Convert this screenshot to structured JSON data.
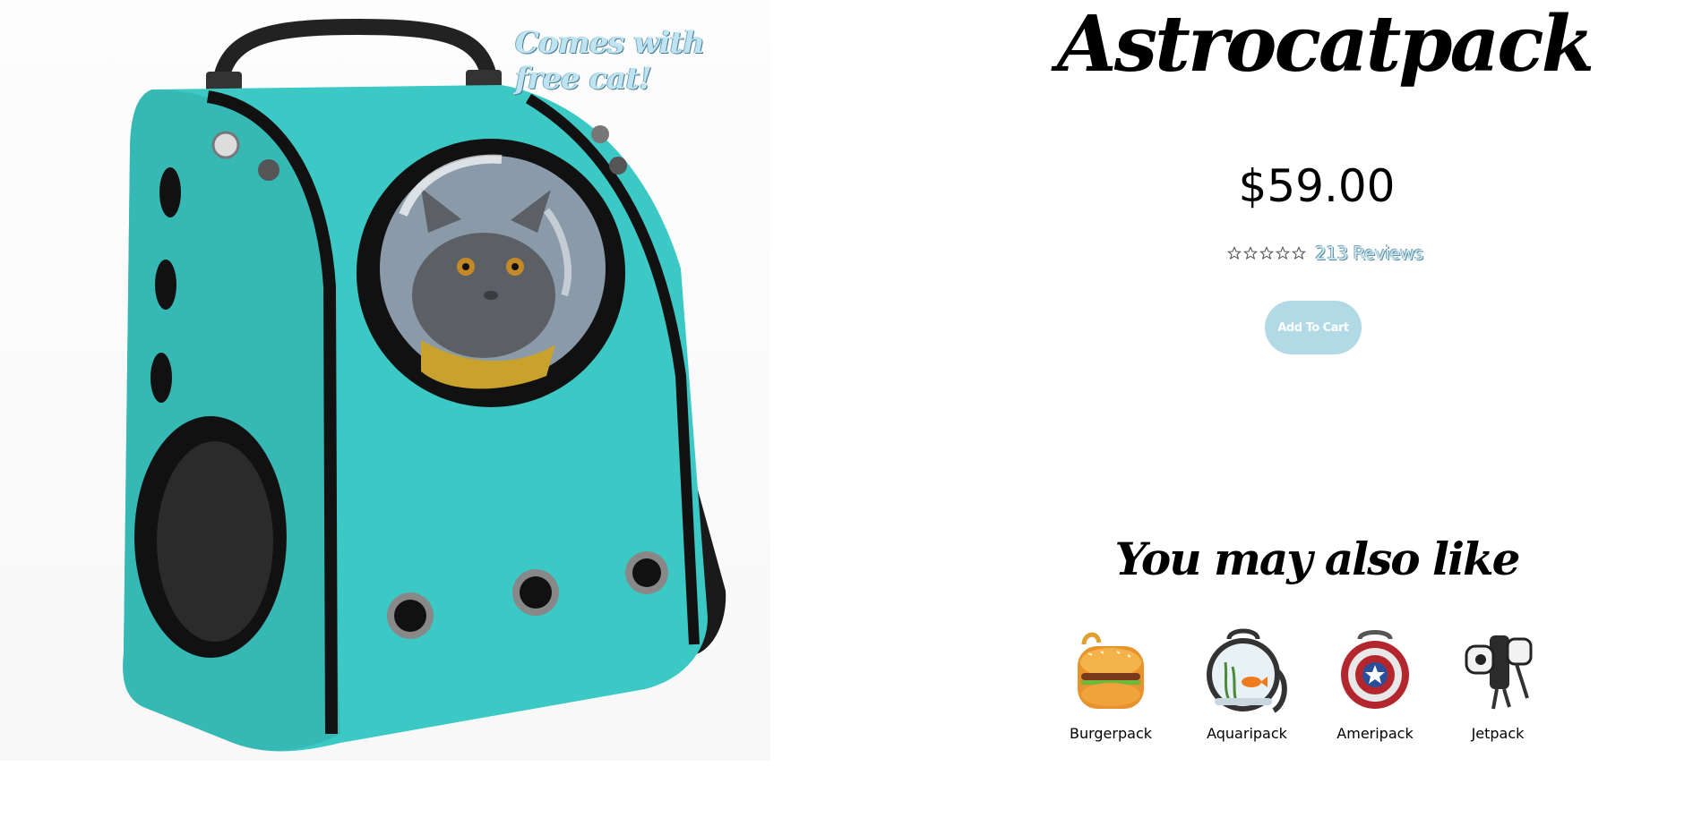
{
  "product": {
    "badge": "Comes with free cat!",
    "title": "Astrocatpack",
    "price": "$59.00",
    "rating_value": 0,
    "rating_max": 5,
    "reviews": "213 Reviews",
    "add_to_cart": "Add To Cart",
    "accent_color": "#b2d9e6",
    "bag_color": "#3cc8c4"
  },
  "recommendations": {
    "heading": "You may also like",
    "items": [
      {
        "label": "Burgerpack",
        "icon": "burger-backpack-icon"
      },
      {
        "label": "Aquaripack",
        "icon": "aquarium-backpack-icon"
      },
      {
        "label": "Ameripack",
        "icon": "shield-backpack-icon"
      },
      {
        "label": "Jetpack",
        "icon": "jetpack-icon"
      }
    ]
  }
}
